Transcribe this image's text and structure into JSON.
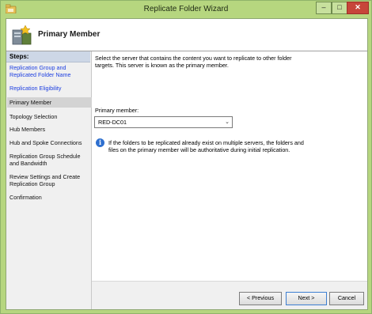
{
  "window": {
    "title": "Replicate Folder Wizard",
    "minimize_icon": "minimize-icon",
    "maximize_icon": "maximize-icon",
    "close_icon": "close-icon"
  },
  "header": {
    "title": "Primary Member"
  },
  "steps": {
    "heading": "Steps:",
    "items": [
      {
        "label": "Replication Group and Replicated Folder Name",
        "state": "link"
      },
      {
        "label": "Replication Eligibility",
        "state": "link"
      },
      {
        "label": "Primary Member",
        "state": "current"
      },
      {
        "label": "Topology Selection",
        "state": "plain"
      },
      {
        "label": "Hub Members",
        "state": "plain"
      },
      {
        "label": "Hub and Spoke Connections",
        "state": "plain"
      },
      {
        "label": "Replication Group Schedule and Bandwidth",
        "state": "plain"
      },
      {
        "label": "Review Settings and Create Replication Group",
        "state": "plain"
      },
      {
        "label": "Confirmation",
        "state": "plain"
      }
    ]
  },
  "main": {
    "description": "Select the server that contains the content you want to replicate to other folder targets. This server is known as the primary member.",
    "primary_member_label": "Primary member:",
    "primary_member_value": "RED-DC01",
    "info_text": "If the folders to be replicated already exist on multiple servers, the folders and files on the primary member will be authoritative during initial replication."
  },
  "buttons": {
    "previous": "< Previous",
    "next": "Next >",
    "cancel": "Cancel"
  },
  "colors": {
    "frame": "#b6d67f",
    "link": "#1c3ee0",
    "info": "#2e6fcf",
    "close": "#c7453a"
  }
}
